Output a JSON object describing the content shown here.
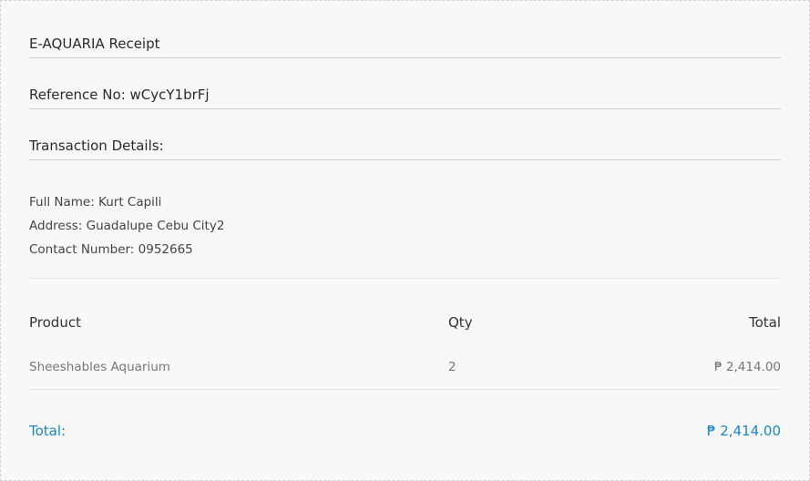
{
  "receipt": {
    "title": "E-AQUARIA Receipt",
    "reference": "Reference No: wCycY1brFj",
    "transaction_heading": "Transaction Details:"
  },
  "customer": {
    "full_name": "Full Name: Kurt Capili",
    "address": "Address: Guadalupe Cebu City2",
    "contact": "Contact Number: 0952665"
  },
  "table": {
    "headers": {
      "product": "Product",
      "qty": "Qty",
      "total": "Total"
    },
    "rows": [
      {
        "product": "Sheeshables Aquarium",
        "qty": "2",
        "total": "₱ 2,414.00"
      }
    ]
  },
  "summary": {
    "label": "Total:",
    "amount": "₱ 2,414.00"
  },
  "colors": {
    "accent": "#1a87c4",
    "background": "#f8f8f8"
  }
}
